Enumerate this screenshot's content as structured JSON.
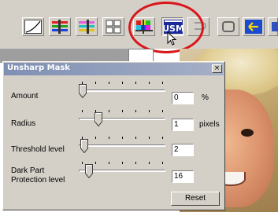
{
  "toolbar": {
    "buttons": [
      {
        "icon": "tone-curve-icon"
      },
      {
        "icon": "color-balance-icon"
      },
      {
        "icon": "rgb-balance-icon"
      },
      {
        "icon": "variations-grid-icon"
      },
      {
        "icon": "hue-saturation-icon"
      },
      {
        "icon": "usm-icon",
        "label": "USM",
        "active": true
      },
      {
        "icon": "undo-icon"
      },
      {
        "icon": "reset-icon"
      },
      {
        "icon": "apply-icon"
      },
      {
        "icon": "panel-icon"
      }
    ],
    "highlight_color": "#d9161c"
  },
  "dialog": {
    "title": "Unsharp Mask",
    "close_label": "×",
    "rows": [
      {
        "label": "Amount",
        "value": "0",
        "unit": "%",
        "slider_fraction": 0.0
      },
      {
        "label": "Radius",
        "value": "1",
        "unit": "pixels",
        "slider_fraction": 0.2
      },
      {
        "label": "Threshold level",
        "value": "2",
        "unit": "",
        "slider_fraction": 0.02
      },
      {
        "label_line1": "Dark Part",
        "label_line2": "Protection level",
        "value": "16",
        "unit": "",
        "slider_fraction": 0.08
      }
    ],
    "reset_label": "Reset"
  },
  "colors": {
    "panel": "#d4d0c8",
    "titlebar_start": "#7f8fb3",
    "titlebar_end": "#a6b0c7"
  }
}
